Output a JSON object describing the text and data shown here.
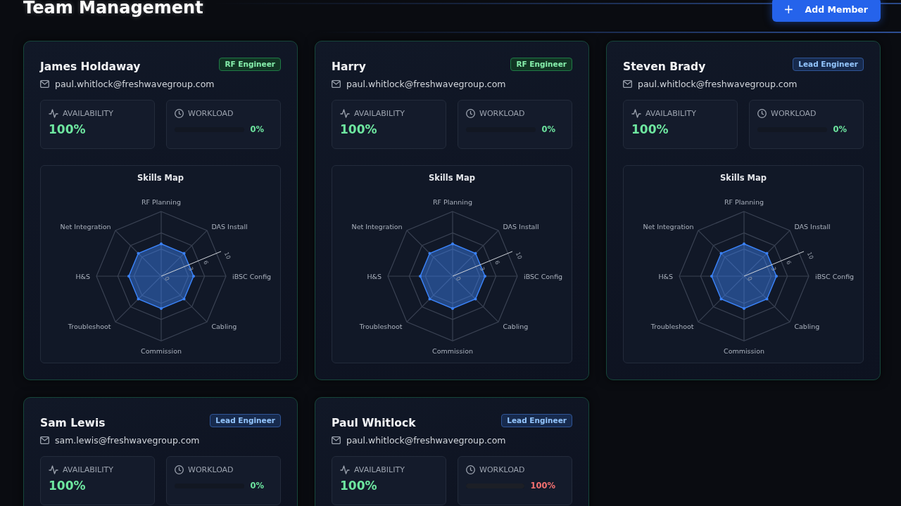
{
  "page": {
    "title": "Team Management",
    "add_button": {
      "label": "Add Member",
      "icon": "+"
    }
  },
  "members": [
    {
      "name": "James Holdaway",
      "role": {
        "label": "RF Engineer",
        "kind": "rf"
      },
      "email": "paul.whitlock@freshwavegroup.com",
      "availability": {
        "label": "AVAILABILITY",
        "value": "100%"
      },
      "workload": {
        "label": "WORKLOAD",
        "level": 0,
        "reading": "0%"
      },
      "skills": {
        "title": "Skills Map",
        "scale_labels": [
          "0",
          "3",
          "6",
          "10"
        ],
        "axes": [
          {
            "label": "RF Planning",
            "level": 0.5
          },
          {
            "label": "Net Integration",
            "level": 0.5
          },
          {
            "label": "DAS Install",
            "level": 0.5
          },
          {
            "label": "H&S",
            "level": 0.5
          },
          {
            "label": "iBSC Config",
            "level": 0.5
          },
          {
            "label": "Troubleshoot",
            "level": 0.5
          },
          {
            "label": "Cabling",
            "level": 0.5
          },
          {
            "label": "Commission",
            "level": 0.5
          }
        ]
      }
    },
    {
      "name": "Harry",
      "role": {
        "label": "RF Engineer",
        "kind": "rf"
      },
      "email": "paul.whitlock@freshwavegroup.com",
      "availability": {
        "label": "AVAILABILITY",
        "value": "100%"
      },
      "workload": {
        "label": "WORKLOAD",
        "level": 0,
        "reading": "0%"
      },
      "skills": {
        "title": "Skills Map",
        "scale_labels": [
          "0",
          "3",
          "6",
          "10"
        ],
        "axes": [
          {
            "label": "RF Planning",
            "level": 0.5
          },
          {
            "label": "Net Integration",
            "level": 0.5
          },
          {
            "label": "DAS Install",
            "level": 0.5
          },
          {
            "label": "H&S",
            "level": 0.5
          },
          {
            "label": "iBSC Config",
            "level": 0.5
          },
          {
            "label": "Troubleshoot",
            "level": 0.5
          },
          {
            "label": "Cabling",
            "level": 0.5
          },
          {
            "label": "Commission",
            "level": 0.5
          }
        ]
      }
    },
    {
      "name": "Steven Brady",
      "role": {
        "label": "Lead Engineer",
        "kind": "lead"
      },
      "email": "paul.whitlock@freshwavegroup.com",
      "availability": {
        "label": "AVAILABILITY",
        "value": "100%"
      },
      "workload": {
        "label": "WORKLOAD",
        "level": 0,
        "reading": "0%"
      },
      "skills": {
        "title": "Skills Map",
        "scale_labels": [
          "0",
          "3",
          "6",
          "10"
        ],
        "axes": [
          {
            "label": "RF Planning",
            "level": 0.5
          },
          {
            "label": "Net Integration",
            "level": 0.5
          },
          {
            "label": "DAS Install",
            "level": 0.5
          },
          {
            "label": "H&S",
            "level": 0.5
          },
          {
            "label": "iBSC Config",
            "level": 0.5
          },
          {
            "label": "Troubleshoot",
            "level": 0.5
          },
          {
            "label": "Cabling",
            "level": 0.5
          },
          {
            "label": "Commission",
            "level": 0.5
          }
        ]
      }
    },
    {
      "name": "Sam Lewis",
      "role": {
        "label": "Lead Engineer",
        "kind": "lead"
      },
      "email": "sam.lewis@freshwavegroup.com",
      "availability": {
        "label": "AVAILABILITY",
        "value": "100%"
      },
      "workload": {
        "label": "WORKLOAD",
        "level": 0,
        "reading": "0%"
      }
    },
    {
      "name": "Paul Whitlock",
      "role": {
        "label": "Lead Engineer",
        "kind": "lead"
      },
      "email": "paul.whitlock@freshwavegroup.com",
      "availability": {
        "label": "AVAILABILITY",
        "value": "100%"
      },
      "workload": {
        "label": "WORKLOAD",
        "level": 1,
        "reading": "100%"
      }
    }
  ]
}
